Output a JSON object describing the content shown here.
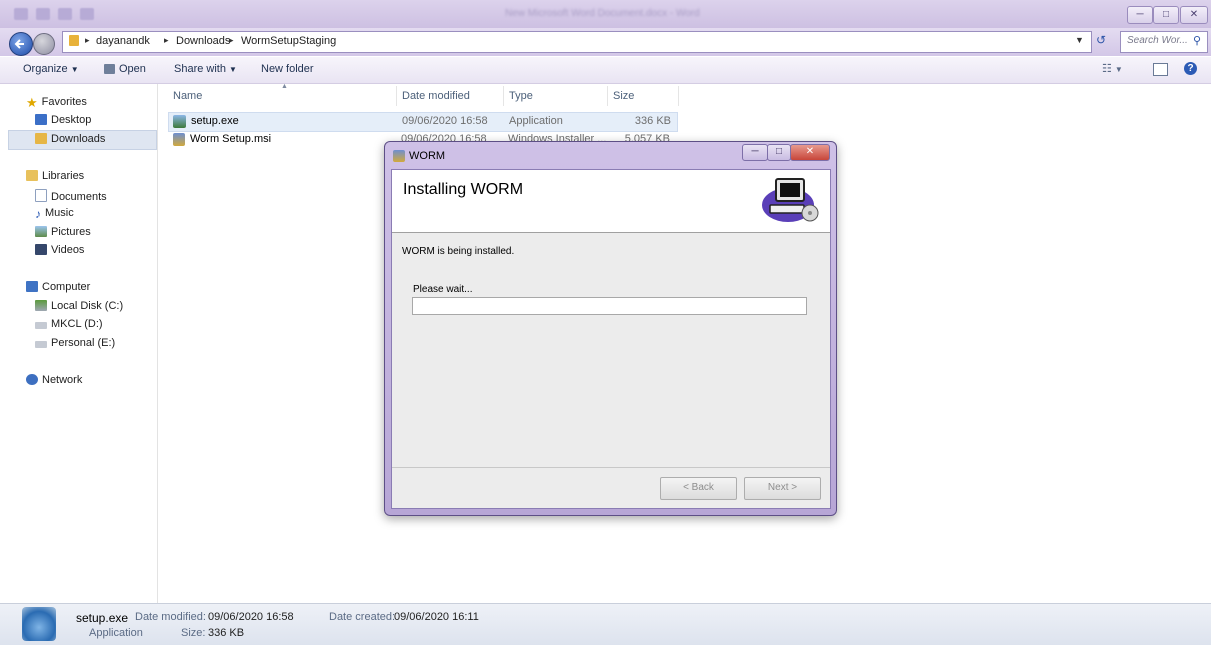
{
  "titlebar": {
    "window_title": "New Microsoft Word Document.docx - Word"
  },
  "address": {
    "crumbs": [
      "dayanandk",
      "Downloads",
      "WormSetupStaging"
    ],
    "search_placeholder": "Search Wor..."
  },
  "toolbar": {
    "organize": "Organize",
    "open": "Open",
    "share_with": "Share with",
    "new_folder": "New folder"
  },
  "nav": {
    "favorites": "Favorites",
    "desktop": "Desktop",
    "downloads": "Downloads",
    "libraries": "Libraries",
    "documents": "Documents",
    "music": "Music",
    "pictures": "Pictures",
    "videos": "Videos",
    "computer": "Computer",
    "local_disk": "Local Disk (C:)",
    "mkcl": "MKCL (D:)",
    "personal": "Personal (E:)",
    "network": "Network"
  },
  "columns": {
    "name": "Name",
    "date": "Date modified",
    "type": "Type",
    "size": "Size"
  },
  "files": [
    {
      "name": "setup.exe",
      "date": "09/06/2020 16:58",
      "type": "Application",
      "size": "336 KB"
    },
    {
      "name": "Worm Setup.msi",
      "date": "09/06/2020 16:58",
      "type": "Windows Installer ...",
      "size": "5,057 KB"
    }
  ],
  "status": {
    "filename": "setup.exe",
    "date_modified_label": "Date modified:",
    "date_modified": "09/06/2020 16:58",
    "date_created_label": "Date created:",
    "date_created": "09/06/2020 16:11",
    "type": "Application",
    "size_label": "Size:",
    "size": "336 KB"
  },
  "dialog": {
    "title": "WORM",
    "heading": "Installing WORM",
    "message": "WORM is being installed.",
    "wait": "Please wait...",
    "progress": 0,
    "back": "< Back",
    "next": "Next >"
  },
  "colors": {
    "accent": "#cdc0e2",
    "selection": "#e5eef9"
  }
}
